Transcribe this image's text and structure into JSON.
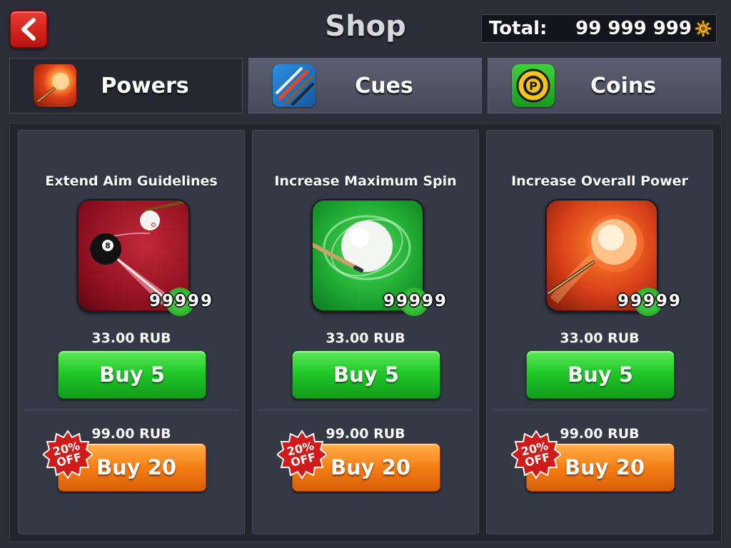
{
  "header": {
    "title": "Shop",
    "total_label": "Total:",
    "total_value": "99 999 999",
    "back_icon": "chevron-left-icon",
    "currency_icon": "gear-coin-icon"
  },
  "tabs": [
    {
      "label": "Powers",
      "icon": "power-ball-icon",
      "active": true
    },
    {
      "label": "Cues",
      "icon": "cues-icon",
      "active": false
    },
    {
      "label": "Coins",
      "icon": "coins-icon",
      "active": false
    }
  ],
  "cards": [
    {
      "title": "Extend Aim Guidelines",
      "icon": "aim-guideline-icon",
      "quantity": "99999",
      "price_small": "33.00 RUB",
      "buy_small_label": "Buy 5",
      "price_large": "99.00 RUB",
      "buy_large_label": "Buy 20",
      "discount": "20%",
      "discount_word": "OFF"
    },
    {
      "title": "Increase Maximum Spin",
      "icon": "spin-ball-icon",
      "quantity": "99999",
      "price_small": "33.00 RUB",
      "buy_small_label": "Buy 5",
      "price_large": "99.00 RUB",
      "buy_large_label": "Buy 20",
      "discount": "20%",
      "discount_word": "OFF"
    },
    {
      "title": "Increase Overall Power",
      "icon": "power-ball-icon",
      "quantity": "99999",
      "price_small": "33.00 RUB",
      "buy_small_label": "Buy 5",
      "price_large": "99.00 RUB",
      "buy_large_label": "Buy 20",
      "discount": "20%",
      "discount_word": "OFF"
    }
  ],
  "colors": {
    "background": "#2b2d38",
    "buy_small": "#21c92a",
    "buy_large": "#f57e15",
    "back_button": "#d8241d",
    "discount_badge": "#d11a1a",
    "quantity_badge": "#2fbf30"
  }
}
